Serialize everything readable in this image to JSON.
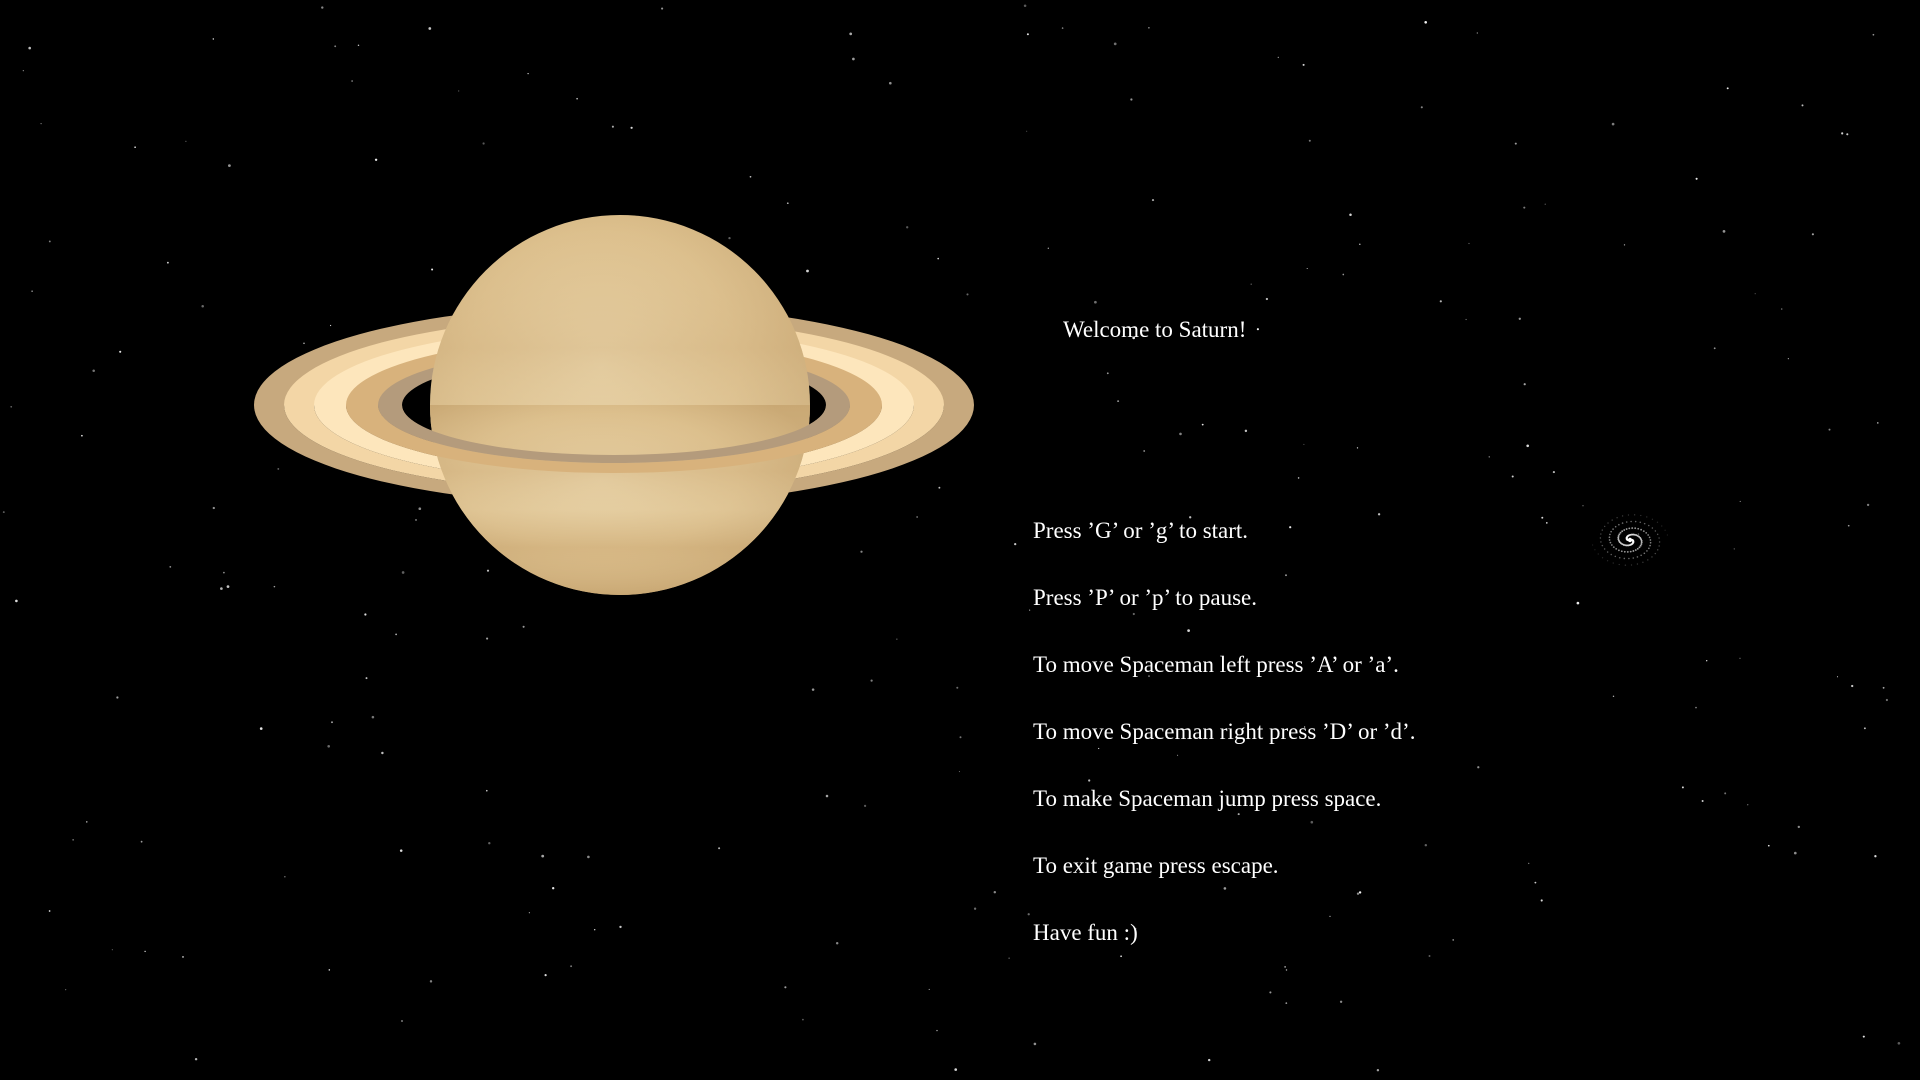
{
  "welcome_text": "Welcome to Saturn!",
  "instructions": [
    "Press ’G’ or ’g’ to start.",
    "Press ’P’ or ’p’ to pause.",
    "To move Spaceman left press ’A’ or ’a’.",
    "To move Spaceman right press ’D’ or ’d’.",
    "To make Spaceman jump press space.",
    "To exit game press escape.",
    "Have fun :)"
  ],
  "colors": {
    "background": "#000000",
    "text": "#ffffff",
    "planet": "#dcc08f",
    "ring_outer": "#c8a97e",
    "ring_light": "#fbdfb0",
    "ring_mid": "#d9b47f",
    "ring_inner": "#b59c7b"
  },
  "icons": {
    "planet": "saturn-planet",
    "galaxy": "spiral-galaxy"
  }
}
